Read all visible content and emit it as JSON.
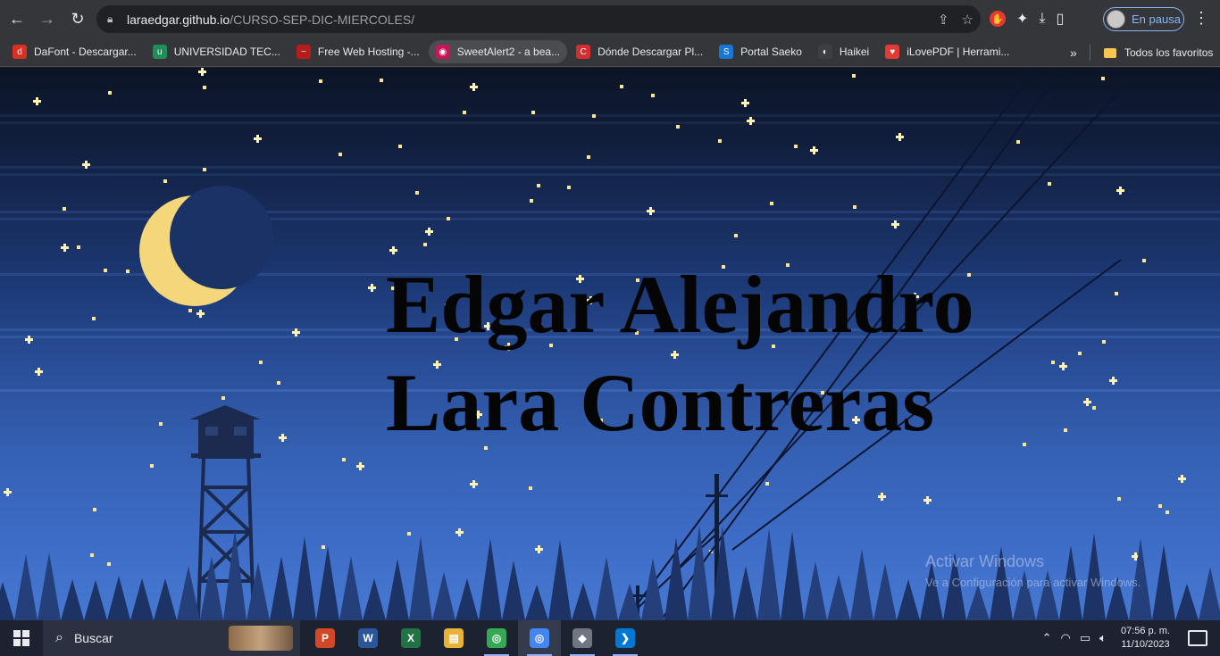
{
  "browser": {
    "url_host": "laraedgar.github.io",
    "url_path": "/CURSO-SEP-DIC-MIERCOLES/",
    "profile_label": "En pausa",
    "nav": {
      "back_icon": "arrow-left-icon",
      "forward_icon": "arrow-right-icon",
      "reload_icon": "reload-icon"
    }
  },
  "bookmarks": {
    "items": [
      {
        "label": "DaFont - Descargar...",
        "color": "#d93025",
        "glyph": "d"
      },
      {
        "label": "UNIVERSIDAD TEC...",
        "color": "#1e8e5a",
        "glyph": "u"
      },
      {
        "label": "Free Web Hosting -...",
        "color": "#b71c1c",
        "glyph": "~"
      },
      {
        "label": "SweetAlert2 - a bea...",
        "color": "#c2185b",
        "glyph": "◉"
      },
      {
        "label": "Dónde Descargar Pl...",
        "color": "#d32f2f",
        "glyph": "C"
      },
      {
        "label": "Portal Saeko",
        "color": "#1976d2",
        "glyph": "S"
      },
      {
        "label": "Haikei",
        "color": "#3c4043",
        "glyph": "◐"
      },
      {
        "label": "iLovePDF | Herrami...",
        "color": "#e53935",
        "glyph": "♥"
      }
    ],
    "more_label": "»",
    "all_favorites_label": "Todos los favoritos"
  },
  "page": {
    "title_line1": "Edgar Alejandro",
    "title_line2": "Lara Contreras"
  },
  "watermark": {
    "line1": "Activar Windows",
    "line2": "Ve a Configuración para activar Windows."
  },
  "taskbar": {
    "search_placeholder": "Buscar",
    "apps": [
      {
        "name": "powerpoint",
        "glyph": "P",
        "color": "#d24726",
        "open": false
      },
      {
        "name": "word",
        "glyph": "W",
        "color": "#2b579a",
        "open": false
      },
      {
        "name": "excel",
        "glyph": "X",
        "color": "#217346",
        "open": false
      },
      {
        "name": "file-explorer",
        "glyph": "▤",
        "color": "#e8b236",
        "open": false
      },
      {
        "name": "chrome",
        "glyph": "◎",
        "color": "#34a853",
        "open": true
      },
      {
        "name": "chrome-profile",
        "glyph": "◎",
        "color": "#4285f4",
        "open": true
      },
      {
        "name": "git",
        "glyph": "◆",
        "color": "#6e7781",
        "open": true
      },
      {
        "name": "vscode",
        "glyph": "❯",
        "color": "#0078d4",
        "open": true
      }
    ],
    "time": "07:56 p. m.",
    "date": "11/10/2023"
  }
}
